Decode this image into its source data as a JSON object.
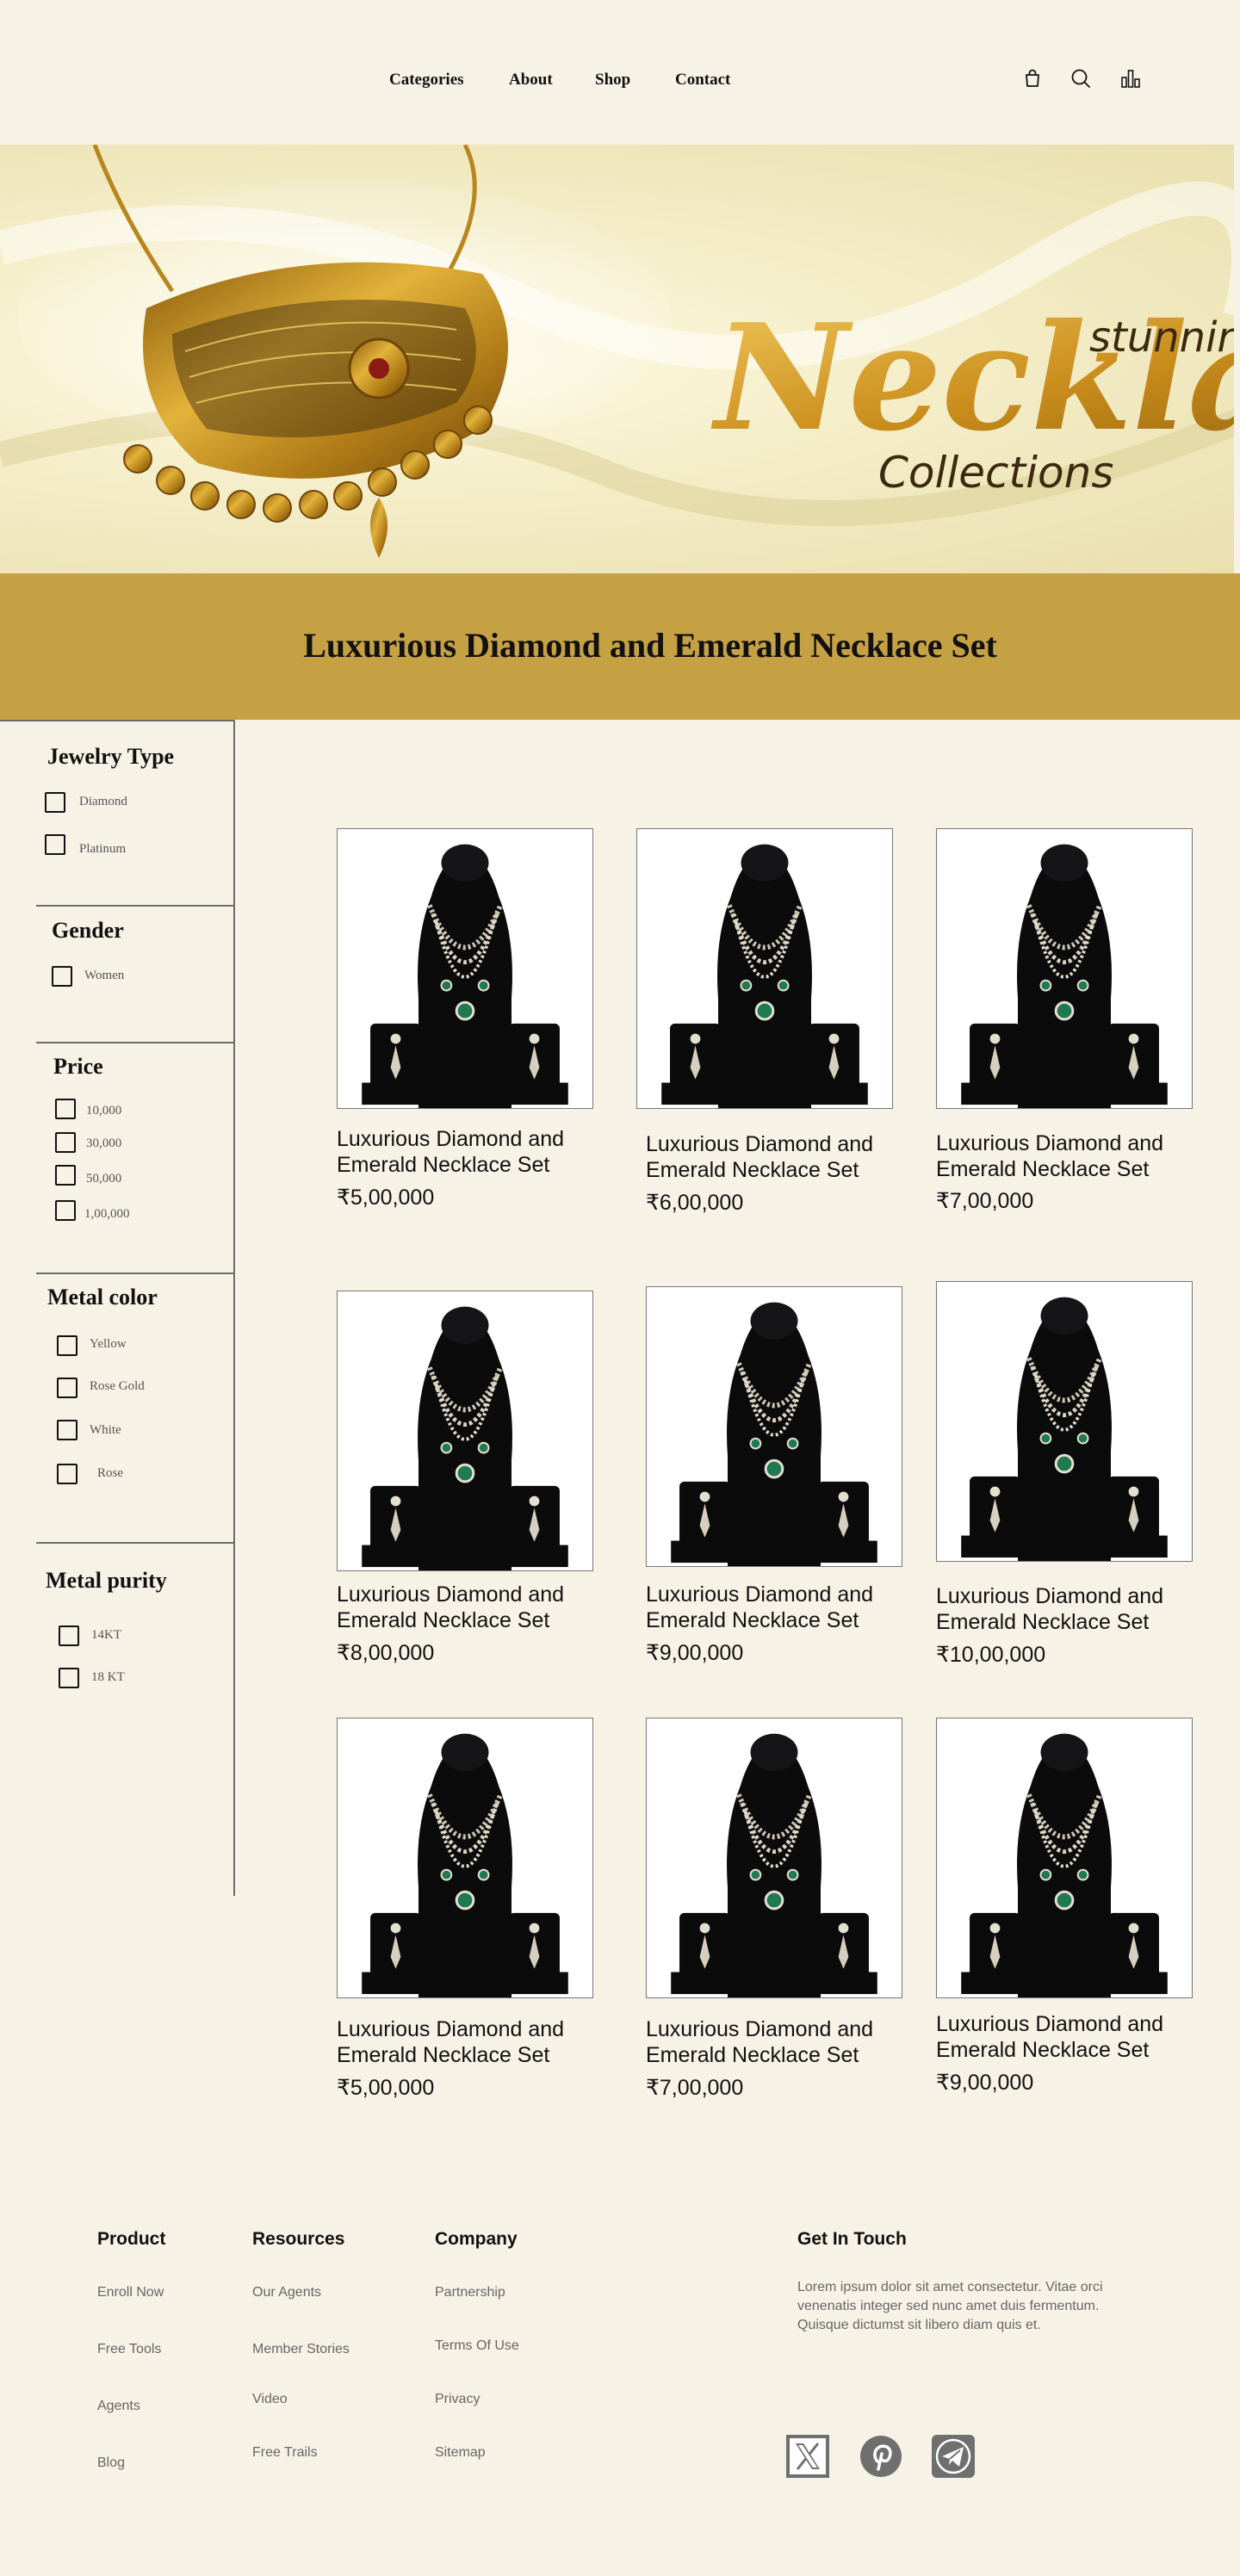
{
  "nav": {
    "links": [
      "Categories",
      "About",
      "Shop",
      "Contact"
    ],
    "icons": [
      "shopping-bag-icon",
      "search-icon",
      "bar-chart-icon"
    ]
  },
  "hero": {
    "script_word": "Necklace",
    "tagline_top": "stunnin",
    "tagline_bottom": "Collections"
  },
  "banner": {
    "title": "Luxurious Diamond and Emerald Necklace Set"
  },
  "filters": {
    "jewelry_type": {
      "title": "Jewelry Type",
      "options": [
        "Diamond",
        "Platinum"
      ]
    },
    "gender": {
      "title": "Gender",
      "options": [
        "Women"
      ]
    },
    "price": {
      "title": "Price",
      "options": [
        "10,000",
        "30,000",
        "50,000",
        "1,00,000"
      ]
    },
    "metal_color": {
      "title": "Metal color",
      "options": [
        "Yellow",
        "Rose Gold",
        "White",
        "Rose"
      ]
    },
    "metal_purity": {
      "title": "Metal purity",
      "options": [
        "14KT",
        "18 KT"
      ]
    }
  },
  "products": [
    {
      "name": "Luxurious Diamond and Emerald Necklace Set",
      "price": "₹5,00,000"
    },
    {
      "name": "Luxurious Diamond and Emerald Necklace Set",
      "price": "₹6,00,000"
    },
    {
      "name": "Luxurious Diamond and Emerald Necklace Set",
      "price": "₹7,00,000"
    },
    {
      "name": "Luxurious Diamond and Emerald Necklace Set",
      "price": "₹8,00,000"
    },
    {
      "name": "Luxurious Diamond and Emerald Necklace Set",
      "price": "₹9,00,000"
    },
    {
      "name": "Luxurious Diamond and Emerald Necklace Set",
      "price": "₹10,00,000"
    },
    {
      "name": "Luxurious Diamond and Emerald Necklace Set",
      "price": "₹5,00,000"
    },
    {
      "name": "Luxurious Diamond and Emerald Necklace Set",
      "price": "₹7,00,000"
    },
    {
      "name": "Luxurious Diamond and Emerald Necklace Set",
      "price": "₹9,00,000"
    }
  ],
  "footer": {
    "product": {
      "title": "Product",
      "links": [
        "Enroll Now",
        "Free Tools",
        "Agents",
        "Blog"
      ]
    },
    "resources": {
      "title": "Resources",
      "links": [
        "Our Agents",
        "Member Stories",
        "Video",
        "Free Trails"
      ]
    },
    "company": {
      "title": "Company",
      "links": [
        "Partnership",
        "Terms Of Use",
        "Privacy",
        "Sitemap"
      ]
    },
    "contact": {
      "title": "Get In Touch",
      "text": "Lorem ipsum dolor sit amet consectetur. Vitae orci venenatis integer sed nunc amet duis fermentum. Quisque dictumst sit libero diam quis et."
    },
    "social": [
      "x-icon",
      "pinterest-icon",
      "telegram-icon"
    ]
  },
  "colors": {
    "page_bg": "#f6f2e6",
    "banner_gold": "#c6a144",
    "text": "#111111"
  }
}
